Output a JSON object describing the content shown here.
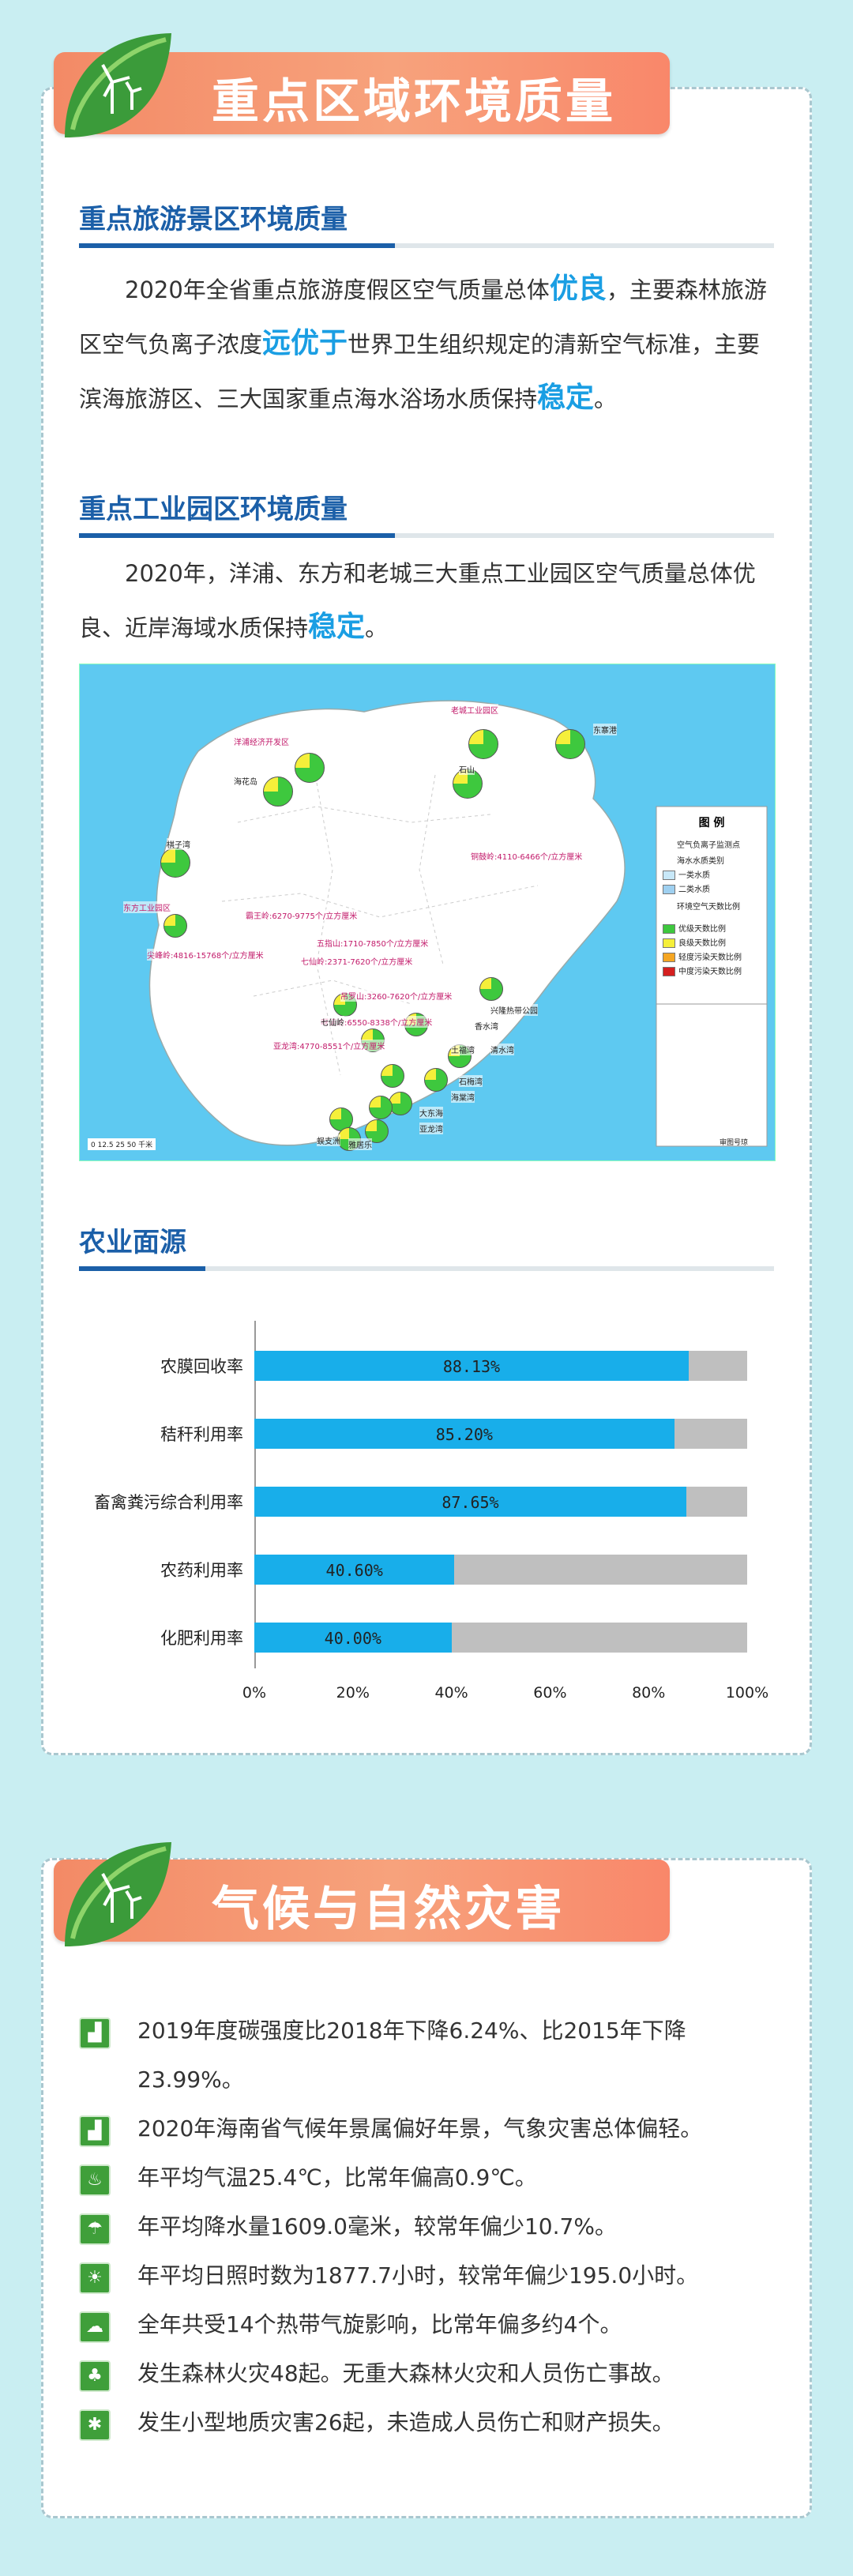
{
  "section1": {
    "title": "重点区域环境质量",
    "tourism": {
      "heading": "重点旅游景区环境质量",
      "p1_a": "2020年全省重点旅游度假区空气质量总体",
      "p1_hl1": "优良",
      "p1_b": "，主要森林旅游区空气负离子浓度",
      "p1_hl2": "远优于",
      "p1_c": "世界卫生组织规定的清新空气标准，主要滨海旅游区、三大国家重点海水浴场水质保持",
      "p1_hl3": "稳定",
      "p1_d": "。"
    },
    "industry": {
      "heading": "重点工业园区环境质量",
      "p_a": "2020年，洋浦、东方和老城三大重点工业园区空气质量总体优良、近岸海域水质保持",
      "p_hl": "稳定",
      "p_b": "。"
    },
    "map": {
      "legend_title": "图 例",
      "legend_items": [
        "空气负离子监测点",
        "海水水质类别",
        "一类水质",
        "二类水质",
        "环境空气天数比例",
        "优级天数比例",
        "良级天数比例",
        "轻度污染天数比例",
        "中度污染天数比例"
      ],
      "place_labels": [
        "老城工业园区",
        "洋浦经济开发区",
        "东寨港",
        "海花岛",
        "棋子湾",
        "东方工业园区",
        "霸王岭:6270-9775个/立方厘米",
        "五指山:1710-7850个/立方厘米",
        "尖峰岭:4816-15768个/立方厘米",
        "七仙岭:2371-7620个/立方厘米",
        "吊罗山:3260-7620个/立方厘米",
        "呀诺达:6550-8338个/立方厘米",
        "亚龙湾:4770-8551个/立方厘米",
        "铜鼓岭:4110-6466个/立方厘米",
        "兴隆热带公园",
        "石梅湾",
        "香水湾",
        "七仙岭",
        "土福湾",
        "清水湾",
        "海棠湾",
        "大东海",
        "亚龙湾",
        "蜈支洲",
        "石山",
        "雅居乐"
      ],
      "scale": [
        "0",
        "12.5",
        "25",
        "50",
        "千米"
      ],
      "note": "审图号琼"
    },
    "agri": {
      "heading": "农业面源"
    }
  },
  "chart_data": {
    "type": "bar",
    "orientation": "horizontal",
    "stacked_to_100": true,
    "categories": [
      "农膜回收率",
      "秸秆利用率",
      "畜禽粪污综合利用率",
      "农药利用率",
      "化肥利用率"
    ],
    "values": [
      88.13,
      85.2,
      87.65,
      40.6,
      40.0
    ],
    "value_labels": [
      "88.13%",
      "85.20%",
      "87.65%",
      "40.60%",
      "40.00%"
    ],
    "x_ticks": [
      "0%",
      "20%",
      "40%",
      "60%",
      "80%",
      "100%"
    ],
    "xlim": [
      0,
      100
    ],
    "colors": {
      "value": "#18aeea",
      "remainder": "#bfbfbf"
    }
  },
  "section2": {
    "title": "气候与自然灾害",
    "items": [
      {
        "icon": "factory-icon",
        "text": "2019年度碳强度比2018年下降6.24%、比2015年下降23.99%。"
      },
      {
        "icon": "factory-icon",
        "text": "2020年海南省气候年景属偏好年景，气象灾害总体偏轻。"
      },
      {
        "icon": "thermometer-icon",
        "text": "年平均气温25.4℃，比常年偏高0.9℃。"
      },
      {
        "icon": "rain-cloud-icon",
        "text": "年平均降水量1609.0毫米，较常年偏少10.7%。"
      },
      {
        "icon": "sun-icon",
        "text": "年平均日照时数为1877.7小时，较常年偏少195.0小时。"
      },
      {
        "icon": "typhoon-icon",
        "text": "全年共受14个热带气旋影响，比常年偏多约4个。"
      },
      {
        "icon": "tree-icon",
        "text": "发生森林火灾48起。无重大森林火灾和人员伤亡事故。"
      },
      {
        "icon": "landslide-icon",
        "text": "发生小型地质灾害26起，未造成人员伤亡和财产损失。"
      }
    ]
  }
}
